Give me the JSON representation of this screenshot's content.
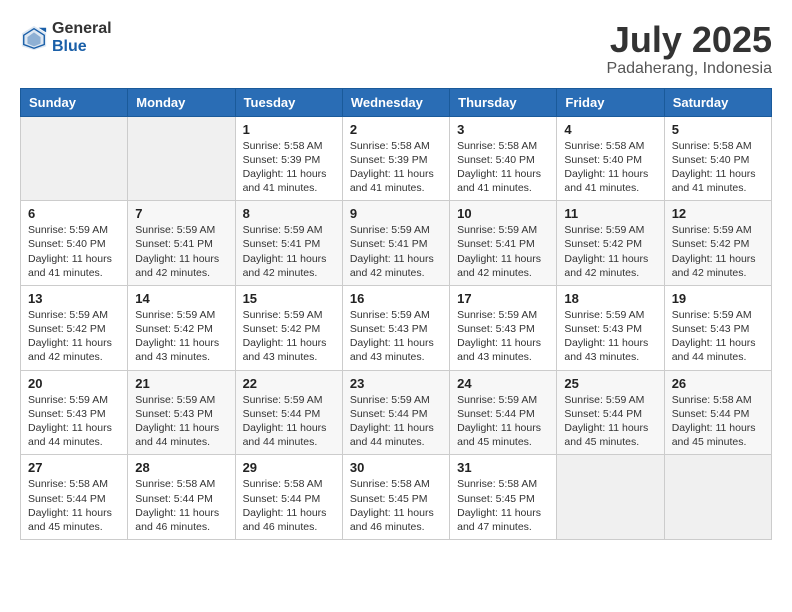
{
  "logo": {
    "general": "General",
    "blue": "Blue"
  },
  "title": {
    "month_year": "July 2025",
    "location": "Padaherang, Indonesia"
  },
  "headers": [
    "Sunday",
    "Monday",
    "Tuesday",
    "Wednesday",
    "Thursday",
    "Friday",
    "Saturday"
  ],
  "weeks": [
    [
      {
        "day": "",
        "info": ""
      },
      {
        "day": "",
        "info": ""
      },
      {
        "day": "1",
        "info": "Sunrise: 5:58 AM\nSunset: 5:39 PM\nDaylight: 11 hours and 41 minutes."
      },
      {
        "day": "2",
        "info": "Sunrise: 5:58 AM\nSunset: 5:39 PM\nDaylight: 11 hours and 41 minutes."
      },
      {
        "day": "3",
        "info": "Sunrise: 5:58 AM\nSunset: 5:40 PM\nDaylight: 11 hours and 41 minutes."
      },
      {
        "day": "4",
        "info": "Sunrise: 5:58 AM\nSunset: 5:40 PM\nDaylight: 11 hours and 41 minutes."
      },
      {
        "day": "5",
        "info": "Sunrise: 5:58 AM\nSunset: 5:40 PM\nDaylight: 11 hours and 41 minutes."
      }
    ],
    [
      {
        "day": "6",
        "info": "Sunrise: 5:59 AM\nSunset: 5:40 PM\nDaylight: 11 hours and 41 minutes."
      },
      {
        "day": "7",
        "info": "Sunrise: 5:59 AM\nSunset: 5:41 PM\nDaylight: 11 hours and 42 minutes."
      },
      {
        "day": "8",
        "info": "Sunrise: 5:59 AM\nSunset: 5:41 PM\nDaylight: 11 hours and 42 minutes."
      },
      {
        "day": "9",
        "info": "Sunrise: 5:59 AM\nSunset: 5:41 PM\nDaylight: 11 hours and 42 minutes."
      },
      {
        "day": "10",
        "info": "Sunrise: 5:59 AM\nSunset: 5:41 PM\nDaylight: 11 hours and 42 minutes."
      },
      {
        "day": "11",
        "info": "Sunrise: 5:59 AM\nSunset: 5:42 PM\nDaylight: 11 hours and 42 minutes."
      },
      {
        "day": "12",
        "info": "Sunrise: 5:59 AM\nSunset: 5:42 PM\nDaylight: 11 hours and 42 minutes."
      }
    ],
    [
      {
        "day": "13",
        "info": "Sunrise: 5:59 AM\nSunset: 5:42 PM\nDaylight: 11 hours and 42 minutes."
      },
      {
        "day": "14",
        "info": "Sunrise: 5:59 AM\nSunset: 5:42 PM\nDaylight: 11 hours and 43 minutes."
      },
      {
        "day": "15",
        "info": "Sunrise: 5:59 AM\nSunset: 5:42 PM\nDaylight: 11 hours and 43 minutes."
      },
      {
        "day": "16",
        "info": "Sunrise: 5:59 AM\nSunset: 5:43 PM\nDaylight: 11 hours and 43 minutes."
      },
      {
        "day": "17",
        "info": "Sunrise: 5:59 AM\nSunset: 5:43 PM\nDaylight: 11 hours and 43 minutes."
      },
      {
        "day": "18",
        "info": "Sunrise: 5:59 AM\nSunset: 5:43 PM\nDaylight: 11 hours and 43 minutes."
      },
      {
        "day": "19",
        "info": "Sunrise: 5:59 AM\nSunset: 5:43 PM\nDaylight: 11 hours and 44 minutes."
      }
    ],
    [
      {
        "day": "20",
        "info": "Sunrise: 5:59 AM\nSunset: 5:43 PM\nDaylight: 11 hours and 44 minutes."
      },
      {
        "day": "21",
        "info": "Sunrise: 5:59 AM\nSunset: 5:43 PM\nDaylight: 11 hours and 44 minutes."
      },
      {
        "day": "22",
        "info": "Sunrise: 5:59 AM\nSunset: 5:44 PM\nDaylight: 11 hours and 44 minutes."
      },
      {
        "day": "23",
        "info": "Sunrise: 5:59 AM\nSunset: 5:44 PM\nDaylight: 11 hours and 44 minutes."
      },
      {
        "day": "24",
        "info": "Sunrise: 5:59 AM\nSunset: 5:44 PM\nDaylight: 11 hours and 45 minutes."
      },
      {
        "day": "25",
        "info": "Sunrise: 5:59 AM\nSunset: 5:44 PM\nDaylight: 11 hours and 45 minutes."
      },
      {
        "day": "26",
        "info": "Sunrise: 5:58 AM\nSunset: 5:44 PM\nDaylight: 11 hours and 45 minutes."
      }
    ],
    [
      {
        "day": "27",
        "info": "Sunrise: 5:58 AM\nSunset: 5:44 PM\nDaylight: 11 hours and 45 minutes."
      },
      {
        "day": "28",
        "info": "Sunrise: 5:58 AM\nSunset: 5:44 PM\nDaylight: 11 hours and 46 minutes."
      },
      {
        "day": "29",
        "info": "Sunrise: 5:58 AM\nSunset: 5:44 PM\nDaylight: 11 hours and 46 minutes."
      },
      {
        "day": "30",
        "info": "Sunrise: 5:58 AM\nSunset: 5:45 PM\nDaylight: 11 hours and 46 minutes."
      },
      {
        "day": "31",
        "info": "Sunrise: 5:58 AM\nSunset: 5:45 PM\nDaylight: 11 hours and 47 minutes."
      },
      {
        "day": "",
        "info": ""
      },
      {
        "day": "",
        "info": ""
      }
    ]
  ]
}
